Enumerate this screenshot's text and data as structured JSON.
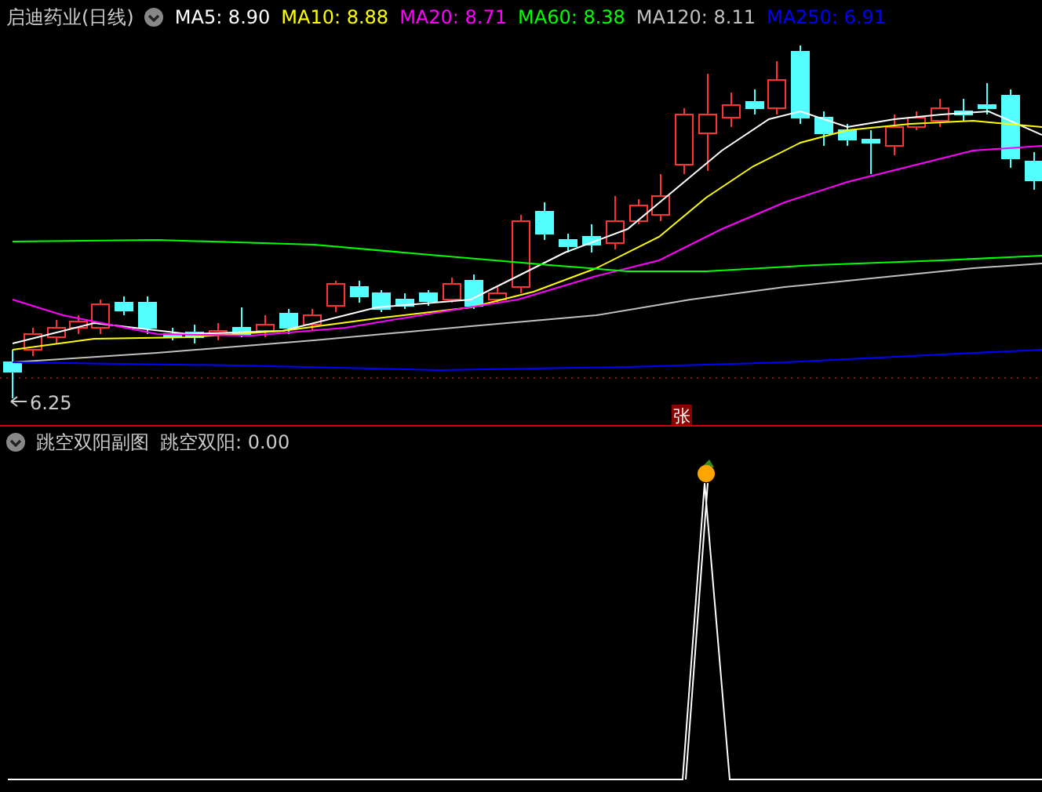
{
  "main_panel": {
    "title": "启迪药业(日线)",
    "indicators": [
      {
        "label": "MA5: 8.90",
        "color": "#ffffff"
      },
      {
        "label": "MA10: 8.88",
        "color": "#ffff00"
      },
      {
        "label": "MA20: 8.71",
        "color": "#ff00ff"
      },
      {
        "label": "MA60: 8.38",
        "color": "#00ff00"
      },
      {
        "label": "MA120: 8.11",
        "color": "#c0c0c0"
      },
      {
        "label": "MA250: 6.91",
        "color": "#0000ff"
      }
    ],
    "low_label": "6.25",
    "marker": "张"
  },
  "sub_panel": {
    "title": "跳空双阳副图",
    "reading": "跳空双阳: 0.00"
  }
}
